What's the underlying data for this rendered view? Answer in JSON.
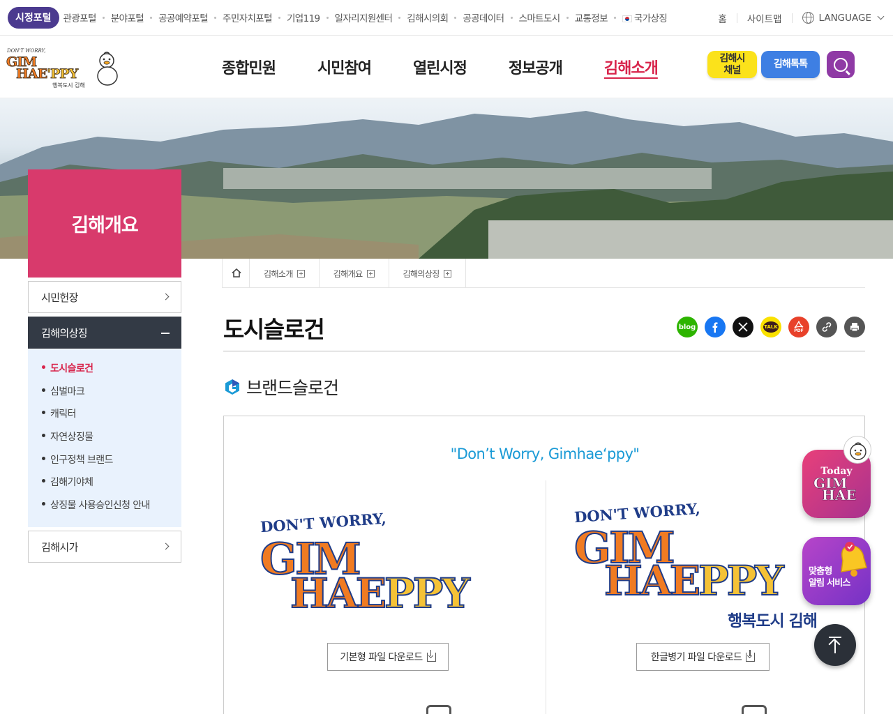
{
  "topbar": {
    "active_portal": "시정포털",
    "portals": [
      "관광포털",
      "분야포털",
      "공공예약포털",
      "주민자치포털",
      "기업119",
      "일자리지원센터",
      "김해시의회",
      "공공데이터",
      "스마트도시",
      "교통정보",
      "국가상징"
    ],
    "home": "홈",
    "sitemap": "사이트맵",
    "language": "LANGUAGE"
  },
  "logo": {
    "small": "DON'T WORRY,",
    "big1": "GIM",
    "big2a": "HAE",
    "big2b": "'PPY",
    "tagline": "행복도시 김해"
  },
  "gnb": [
    "종합민원",
    "시민참여",
    "열린시정",
    "정보공개",
    "김해소개"
  ],
  "gnb_active_index": 4,
  "header_buttons": {
    "channel": "김해시\n채널",
    "talk": "김해톡톡",
    "search_icon": "search-icon"
  },
  "sidebar": {
    "title": "김해개요",
    "items": [
      {
        "label": "시민헌장"
      },
      {
        "label": "김해의상징"
      },
      {
        "label": "김해시가"
      }
    ],
    "sub_items": [
      "도시슬로건",
      "심벌마크",
      "캐릭터",
      "자연상징물",
      "인구정책 브랜드",
      "김해기야체",
      "상징물 사용승인신청 안내"
    ]
  },
  "breadcrumb": [
    "김해소개",
    "김해개요",
    "김해의상징"
  ],
  "page_title": "도시슬로건",
  "share": {
    "blog": "blog",
    "talk": "TALK",
    "pdf": "PDF"
  },
  "section_title": "브랜드슬로건",
  "slogan": "\"Don’t Worry, Gimhae‘ppy\"",
  "brand_left": {
    "small": "DON'T WORRY,",
    "big1": "GIM",
    "big2a": "HAE",
    "big2b": "PPY"
  },
  "brand_right": {
    "small": "DON'T WORRY,",
    "big1": "GIM",
    "big2a": "HAE",
    "big2b": "PPY",
    "tagline": "행복도시 김해"
  },
  "downloads": {
    "basic": "기본형 파일 다운로드",
    "hwp": "한글병기 파일 다운로드"
  },
  "floating": {
    "today_1": "Today",
    "today_2": "GIM",
    "today_3": "HAE",
    "alarm": "맞춤형\n알림 서비스"
  },
  "colors": {
    "accent": "#d8244b",
    "portal": "#4b3a8f",
    "side": "#d83a6c",
    "slogan": "#1a9ad6"
  }
}
